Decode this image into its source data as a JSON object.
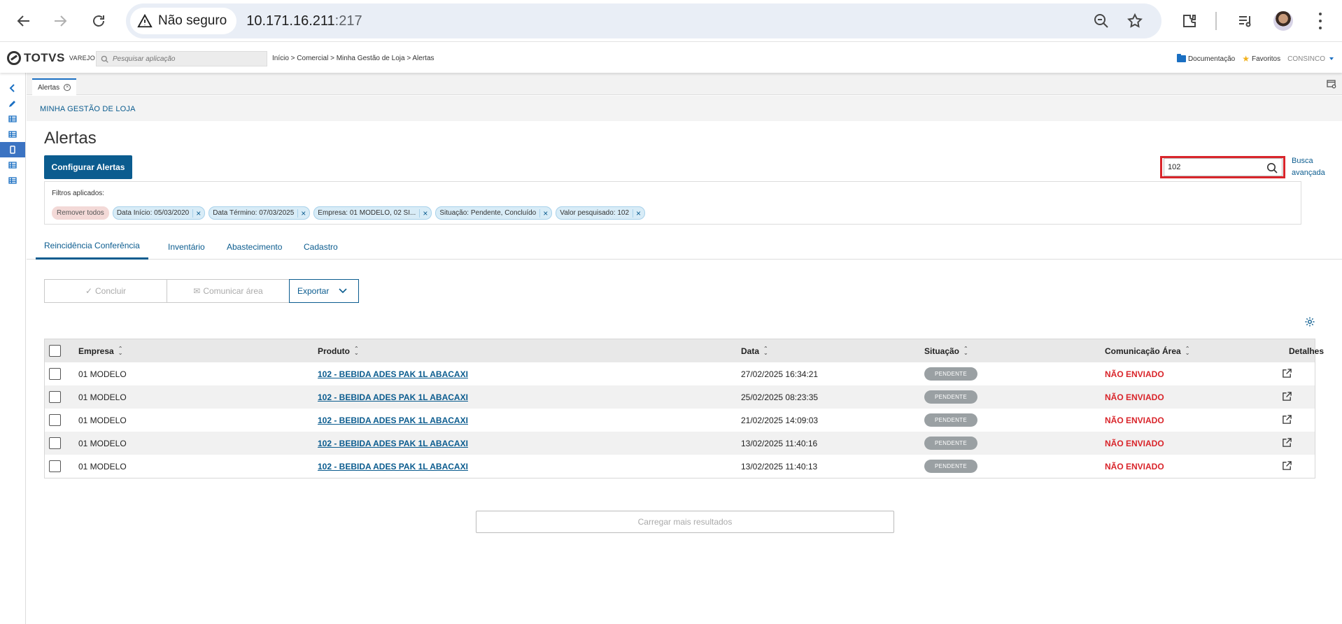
{
  "browser": {
    "security_label": "Não seguro",
    "url_host": "10.171.16.211",
    "url_port": ":217"
  },
  "app": {
    "logo_text": "TOTVS",
    "logo_sub": "VAREJO",
    "search_placeholder": "Pesquisar aplicação",
    "breadcrumb": "Início > Comercial > Minha Gestão de Loja > Alertas",
    "links": {
      "documentation": "Documentação",
      "favorites": "Favoritos",
      "user": "CONSINCO"
    }
  },
  "tabstrip": {
    "tab_label": "Alertas"
  },
  "page": {
    "section": "MINHA GESTÃO DE LOJA",
    "title": "Alertas",
    "config_button": "Configurar Alertas",
    "search_value": "102",
    "advanced_search": "Busca avançada",
    "filters_label": "Filtros aplicados:",
    "remove_all": "Remover todos",
    "filters": [
      "Data Início: 05/03/2020",
      "Data Término: 07/03/2025",
      "Empresa: 01 MODELO, 02 SI...",
      "Situação: Pendente, Concluído",
      "Valor pesquisado: 102"
    ],
    "tabs": [
      "Reincidência Conferência",
      "Inventário",
      "Abastecimento",
      "Cadastro"
    ],
    "actions": {
      "conclude": "Concluir",
      "communicate": "Comunicar área",
      "export": "Exportar"
    },
    "columns": [
      "Empresa",
      "Produto",
      "Data",
      "Situação",
      "Comunicação Área",
      "Detalhes"
    ],
    "rows": [
      {
        "empresa": "01 MODELO",
        "produto": "102 - BEBIDA ADES PAK 1L ABACAXI",
        "data": "27/02/2025 16:34:21",
        "situacao": "PENDENTE",
        "comunicacao": "NÃO ENVIADO"
      },
      {
        "empresa": "01 MODELO",
        "produto": "102 - BEBIDA ADES PAK 1L ABACAXI",
        "data": "25/02/2025 08:23:35",
        "situacao": "PENDENTE",
        "comunicacao": "NÃO ENVIADO"
      },
      {
        "empresa": "01 MODELO",
        "produto": "102 - BEBIDA ADES PAK 1L ABACAXI",
        "data": "21/02/2025 14:09:03",
        "situacao": "PENDENTE",
        "comunicacao": "NÃO ENVIADO"
      },
      {
        "empresa": "01 MODELO",
        "produto": "102 - BEBIDA ADES PAK 1L ABACAXI",
        "data": "13/02/2025 11:40:16",
        "situacao": "PENDENTE",
        "comunicacao": "NÃO ENVIADO"
      },
      {
        "empresa": "01 MODELO",
        "produto": "102 - BEBIDA ADES PAK 1L ABACAXI",
        "data": "13/02/2025 11:40:13",
        "situacao": "PENDENTE",
        "comunicacao": "NÃO ENVIADO"
      }
    ],
    "load_more": "Carregar mais resultados"
  },
  "colors": {
    "primary": "#0b5c8f",
    "alert_red": "#d9252b",
    "badge_gray": "#9aa0a3"
  }
}
